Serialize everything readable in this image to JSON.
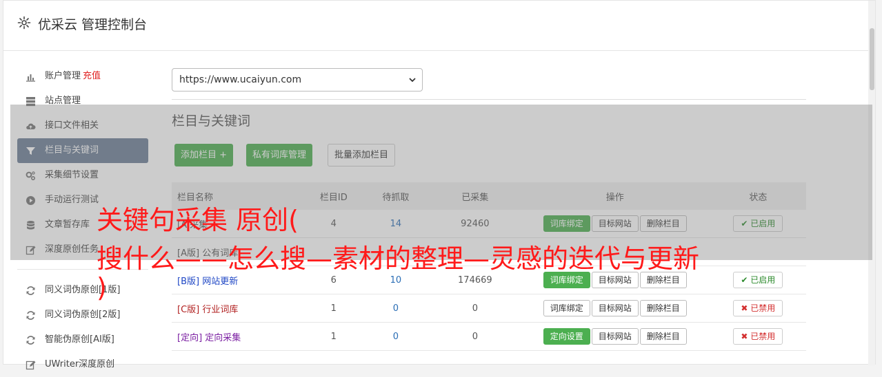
{
  "header": {
    "title": "优采云 管理控制台",
    "icon": "gear-icon"
  },
  "sidebar": {
    "items": [
      {
        "label": "账户管理",
        "extra": "充值",
        "icon": "bar-chart-icon"
      },
      {
        "label": "站点管理",
        "icon": "server-icon"
      },
      {
        "label": "接口文件相关",
        "icon": "cloud-upload-icon"
      },
      {
        "label": "栏目与关键词",
        "icon": "filter-icon",
        "active": true
      },
      {
        "label": "采集细节设置",
        "icon": "cogs-icon"
      },
      {
        "label": "手动运行测试",
        "icon": "play-circle-icon"
      },
      {
        "label": "文章暂存库",
        "icon": "database-icon"
      },
      {
        "label": "深度原创任务",
        "icon": "edit-icon"
      }
    ],
    "items2": [
      {
        "label": "同义词伪原创[1版]",
        "icon": "refresh-icon"
      },
      {
        "label": "同义词伪原创[2版]",
        "icon": "refresh-icon"
      },
      {
        "label": "智能伪原创[AI版]",
        "icon": "refresh-icon"
      },
      {
        "label": "UWriter深度原创",
        "icon": "edit-icon"
      }
    ]
  },
  "main": {
    "site_url": "https://www.ucaiyun.com",
    "section_title": "栏目与关键词",
    "buttons": {
      "add": "添加栏目 +",
      "private": "私有词库管理",
      "batch": "批量添加栏目"
    },
    "table": {
      "headers": [
        "栏目名称",
        "栏目ID",
        "待抓取",
        "已采集",
        "操作",
        "状态"
      ],
      "rows": [
        {
          "tag": "[A",
          "name": "采集",
          "id": "4",
          "pending": "14",
          "collected": "92460",
          "op1": "词库绑定",
          "op1_green": true,
          "op2": "目标网站",
          "op3": "删除栏目",
          "status": "已启用",
          "on": true,
          "color": "c-gray"
        },
        {
          "tag": "[A版]",
          "name": "公有词库",
          "id": "",
          "pending": "",
          "collected": "",
          "op1": "",
          "op1_green": true,
          "op2": "",
          "op3": "",
          "status": "",
          "on": false,
          "color": "c-gray"
        },
        {
          "tag": "[B版]",
          "name": "网站更新",
          "id": "6",
          "pending": "10",
          "collected": "174669",
          "op1": "词库绑定",
          "op1_green": true,
          "op2": "目标网站",
          "op3": "删除栏目",
          "status": "已启用",
          "on": true,
          "color": "c-blue"
        },
        {
          "tag": "[C版]",
          "name": "行业词库",
          "id": "1",
          "pending": "0",
          "collected": "0",
          "op1": "词库绑定",
          "op1_green": false,
          "op2": "目标网站",
          "op3": "删除栏目",
          "status": "已禁用",
          "on": false,
          "color": "c-red"
        },
        {
          "tag": "[定向]",
          "name": "定向采集",
          "id": "1",
          "pending": "0",
          "collected": "0",
          "op1": "定向设置",
          "op1_green": true,
          "op2": "目标网站",
          "op3": "删除栏目",
          "status": "已禁用",
          "on": false,
          "color": "c-purple"
        }
      ]
    }
  },
  "overlay_text": {
    "line1": "关键句采集 原创(",
    "line2": "搜什么——怎么搜—素材的整理—灵感的迭代与更新",
    "line3": ")"
  }
}
